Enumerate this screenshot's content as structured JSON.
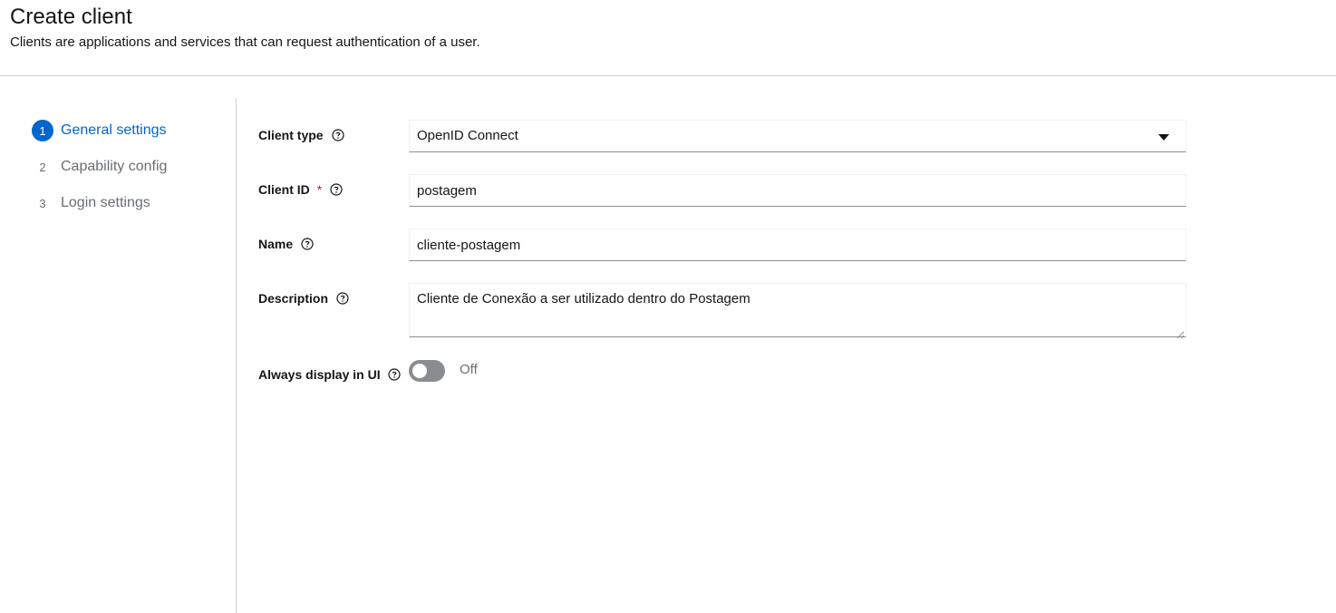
{
  "header": {
    "title": "Create client",
    "subtitle": "Clients are applications and services that can request authentication of a user."
  },
  "wizard": {
    "steps": [
      {
        "number": "1",
        "label": "General settings",
        "active": true
      },
      {
        "number": "2",
        "label": "Capability config",
        "active": false
      },
      {
        "number": "3",
        "label": "Login settings",
        "active": false
      }
    ]
  },
  "form": {
    "client_type": {
      "label": "Client type",
      "value": "OpenID Connect"
    },
    "client_id": {
      "label": "Client ID",
      "required_mark": "*",
      "value": "postagem"
    },
    "name": {
      "label": "Name",
      "value": "cliente-postagem"
    },
    "description": {
      "label": "Description",
      "value": "Cliente de Conexão a ser utilizado dentro do Postagem"
    },
    "always_display": {
      "label": "Always display in UI",
      "state": "Off"
    }
  },
  "colors": {
    "accent": "#0066cc",
    "required": "#c9190b",
    "toggle_off": "#8a8d90"
  }
}
